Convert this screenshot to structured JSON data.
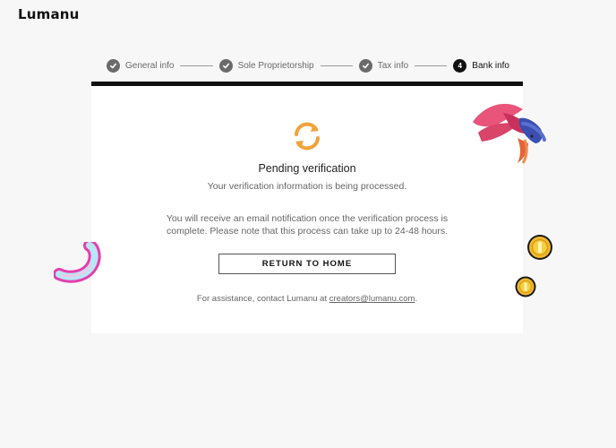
{
  "brand": {
    "logo_text": "Lumanu"
  },
  "stepper": {
    "steps": [
      {
        "label": "General info",
        "state": "done"
      },
      {
        "label": "Sole Proprietorship",
        "state": "done"
      },
      {
        "label": "Tax info",
        "state": "done"
      },
      {
        "label": "Bank info",
        "number": "4",
        "state": "current"
      }
    ]
  },
  "card": {
    "icon": "sync-icon",
    "title": "Pending verification",
    "subtitle": "Your verification information is being processed.",
    "note": "You will receive an email notification once the verification process is complete. Please note that this process can take up to 24-48 hours.",
    "button_label": "RETURN TO HOME",
    "assist_prefix": "For assistance, contact Lumanu at ",
    "assist_email": "creators@lumanu.com",
    "assist_suffix": "."
  },
  "colors": {
    "accent": "#f0a23a",
    "header_bar": "#111111",
    "step_done": "#6a6a6a"
  }
}
